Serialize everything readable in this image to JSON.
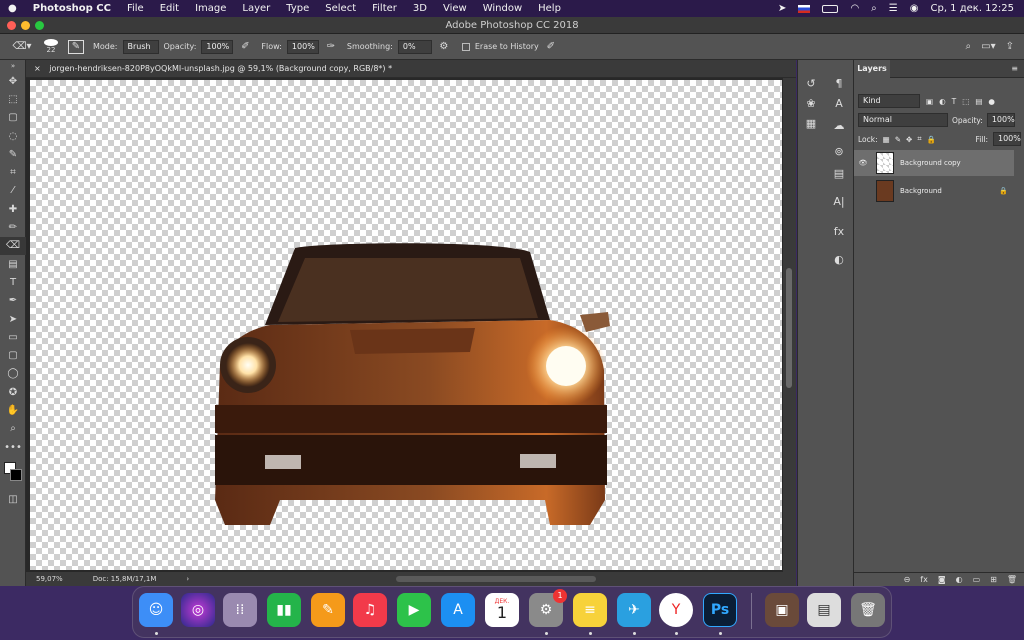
{
  "menubar": {
    "apple": "",
    "app_name": "Photoshop CC",
    "items": [
      "File",
      "Edit",
      "Image",
      "Layer",
      "Type",
      "Select",
      "Filter",
      "3D",
      "View",
      "Window",
      "Help"
    ],
    "clock": "Ср, 1 дек.  12:25"
  },
  "window": {
    "title": "Adobe Photoshop CC 2018"
  },
  "options": {
    "brush_size": "22",
    "mode_label": "Mode:",
    "mode_value": "Brush",
    "opacity_label": "Opacity:",
    "opacity_value": "100%",
    "flow_label": "Flow:",
    "flow_value": "100%",
    "smoothing_label": "Smoothing:",
    "smoothing_value": "0%",
    "erase_history_label": "Erase to History"
  },
  "document": {
    "tab_title": "jorgen-hendriksen-820P8yOQkMI-unsplash.jpg @ 59,1% (Background copy, RGB/8*) *",
    "zoom": "59,07%",
    "doc_size": "Doc: 15,8M/17,1M"
  },
  "layers_panel": {
    "tab": "Layers",
    "filter_kind": "Kind",
    "blend_mode": "Normal",
    "opacity_label": "Opacity:",
    "opacity_value": "100%",
    "lock_label": "Lock:",
    "fill_label": "Fill:",
    "fill_value": "100%",
    "layers": [
      {
        "name": "Background copy",
        "visible": true,
        "selected": true
      },
      {
        "name": "Background",
        "visible": false,
        "locked": true
      }
    ]
  },
  "dock": {
    "calendar_month": "ДЕК.",
    "calendar_day": "1",
    "settings_badge": "1",
    "photoshop_label": "Ps"
  },
  "colors": {
    "menubar": "#2b1a4a",
    "panel": "#535353",
    "dark": "#3a3a3a"
  }
}
